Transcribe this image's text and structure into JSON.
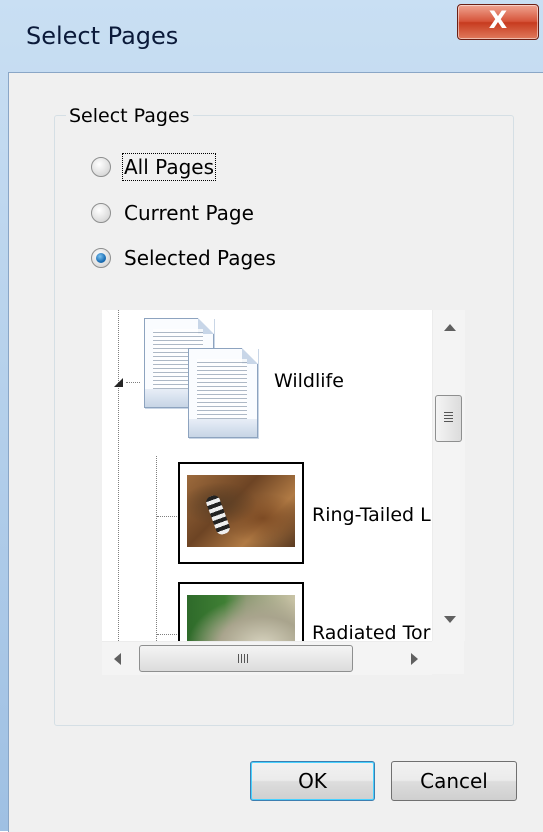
{
  "window": {
    "title": "Select Pages",
    "close_label": "X"
  },
  "group": {
    "legend": "Select Pages",
    "options": [
      {
        "label": "All Pages",
        "checked": false
      },
      {
        "label": "Current Page",
        "checked": false
      },
      {
        "label": "Selected Pages",
        "checked": true
      }
    ]
  },
  "tree": {
    "root": {
      "label": "Wildlife",
      "icon": "multi-page-document-icon"
    },
    "children": [
      {
        "label": "Ring-Tailed L",
        "icon": "ring-tailed-lemur-photo"
      },
      {
        "label": "Radiated Tor",
        "icon": "radiated-tortoise-photo"
      }
    ],
    "hscroll_grip": "III"
  },
  "buttons": {
    "ok": "OK",
    "cancel": "Cancel"
  },
  "colors": {
    "accent": "#1b6fb6",
    "close": "#c73b1f",
    "title_bar": "#b7d1ec"
  }
}
